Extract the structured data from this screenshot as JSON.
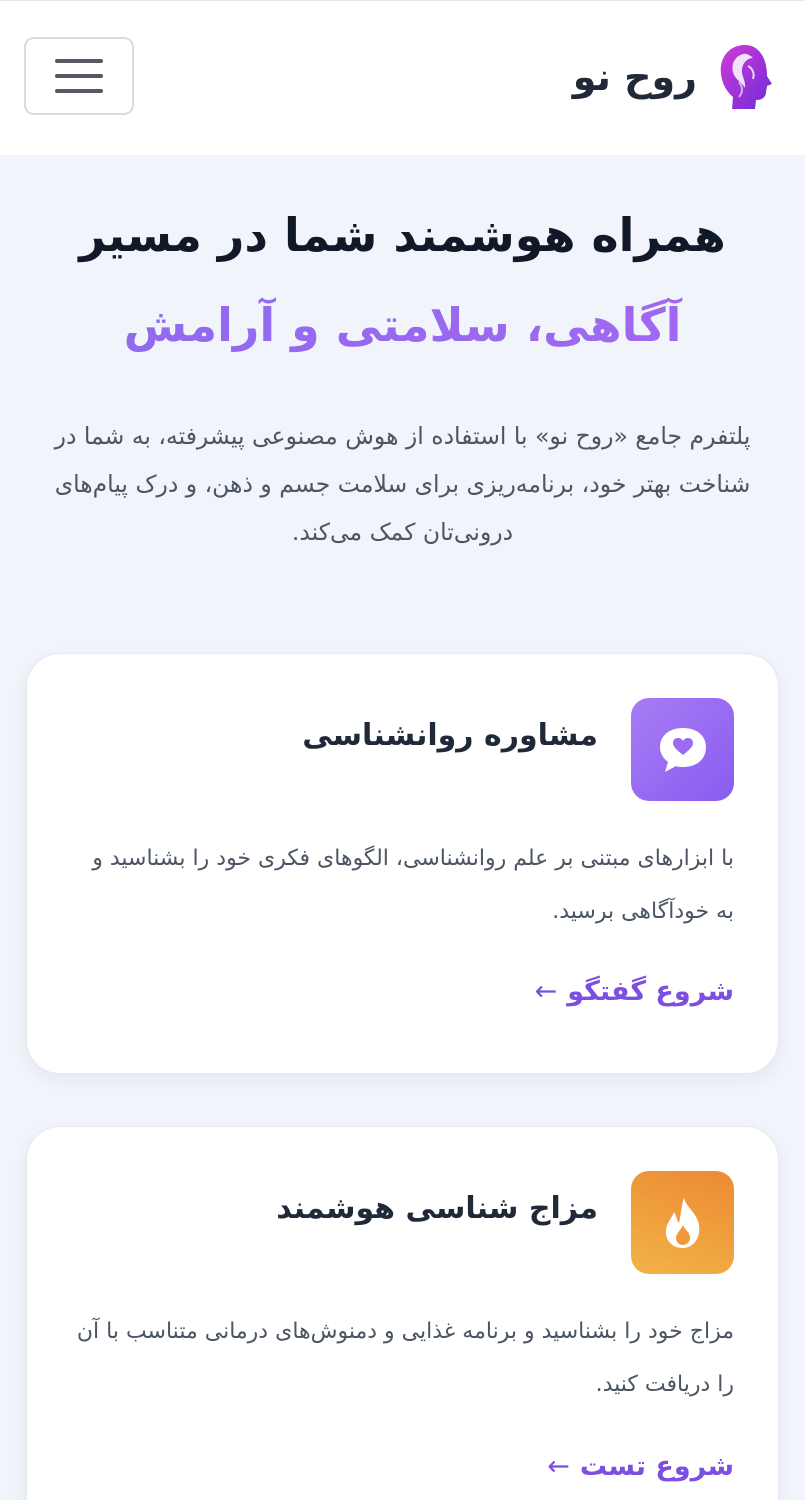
{
  "header": {
    "brand_name": "روح نو",
    "logo_icon": "woman-head-logo-icon",
    "menu_icon": "hamburger-menu-icon"
  },
  "hero": {
    "title_line1": "همراه هوشمند شما در مسیر",
    "title_line2": "آگاهی، سلامتی و آرامش",
    "description": "پلتفرم جامع «روح نو» با استفاده از هوش مصنوعی پیشرفته، به شما در شناخت بهتر خود، برنامه‌ریزی برای سلامت جسم و ذهن، و درک پیام‌های درونی‌تان کمک می‌کند."
  },
  "cards": [
    {
      "title": "مشاوره روانشناسی",
      "description": "با ابزارهای مبتنی بر علم روانشناسی، الگوهای فکری خود را بشناسید و به خودآگاهی برسید.",
      "link_label": "شروع گفتگو",
      "icon": "heart-chat-bubble-icon",
      "color": "#9b6cf2"
    },
    {
      "title": "مزاج شناسی هوشمند",
      "description": "مزاج خود را بشناسید و برنامه غذایی و دمنوش‌های درمانی متناسب با آن را دریافت کنید.",
      "link_label": "شروع تست",
      "icon": "flame-icon",
      "color": "#ef9a3a"
    }
  ],
  "colors": {
    "accent": "#7c4fe0",
    "gradient_purple": "#8b6cf0",
    "background": "#f1f4fb"
  },
  "link_arrow": "←"
}
